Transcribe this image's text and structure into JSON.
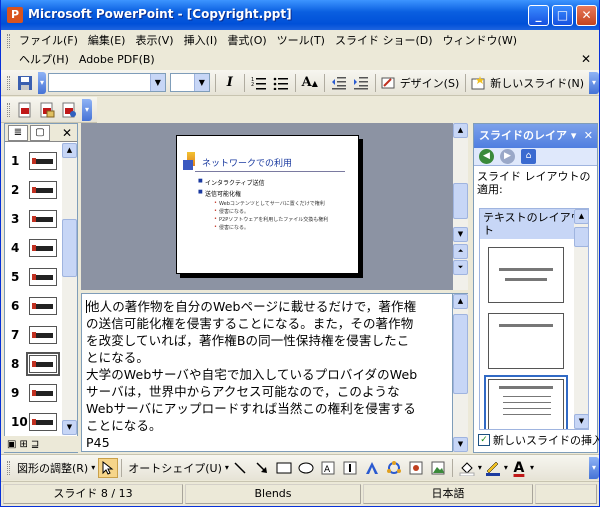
{
  "window": {
    "title": "Microsoft PowerPoint - [Copyright.ppt]",
    "controls": {
      "minimize": "_",
      "maximize": "□",
      "close": "✕"
    }
  },
  "menu": {
    "row1": [
      "ファイル(F)",
      "編集(E)",
      "表示(V)",
      "挿入(I)",
      "書式(O)",
      "ツール(T)",
      "スライド ショー(D)",
      "ウィンドウ(W)"
    ],
    "row2": [
      "ヘルプ(H)",
      "Adobe PDF(B)"
    ],
    "close_glyph": "✕"
  },
  "toolbar": {
    "font_name": "",
    "font_size": "",
    "design_label": "デザイン(S)",
    "new_slide_label": "新しいスライド(N)"
  },
  "thumbnails": {
    "numbers": [
      "1",
      "2",
      "3",
      "4",
      "5",
      "6",
      "7",
      "8",
      "9",
      "10"
    ],
    "selected": 8
  },
  "slide": {
    "title": "ネットワークでの利用",
    "bullets": [
      {
        "level": 1,
        "text": "インタラクティブ送信"
      },
      {
        "level": 1,
        "text": "送信可能化権"
      },
      {
        "level": 2,
        "text": "Webコンテンツとしてサーバに置くだけで権利"
      },
      {
        "level": 2,
        "text": "侵害になる。"
      },
      {
        "level": 2,
        "text": "P2Pソフトウェアを利用したファイル交換も権利"
      },
      {
        "level": 2,
        "text": "侵害になる。"
      }
    ]
  },
  "notes": {
    "lines": [
      "他人の著作物を自分のWebページに載せるだけで，著作権",
      "の送信可能化権を侵害することになる。また，その著作物",
      "を改変していれば，著作権Bの同一性保持権を侵害したこ",
      "とになる。",
      "大学のWebサーバや自宅で加入しているプロバイダのWeb",
      "サーバは，世界中からアクセス可能なので，このような",
      "Webサーバにアップロードすれば当然この権利を侵害する",
      "ことになる。",
      "P45"
    ]
  },
  "taskpane": {
    "title": "スライドのレイア",
    "apply_label": "スライド レイアウトの適用:",
    "section": "テキストのレイアウト",
    "checkbox_label": "新しいスライドの挿入",
    "checkbox_checked": "✓"
  },
  "drawing": {
    "adjust_label": "図形の調整(R)",
    "autoshape_label": "オートシェイプ(U)"
  },
  "status": {
    "slide_indicator": "スライド 8 / 13",
    "design": "Blends",
    "language": "日本語"
  }
}
